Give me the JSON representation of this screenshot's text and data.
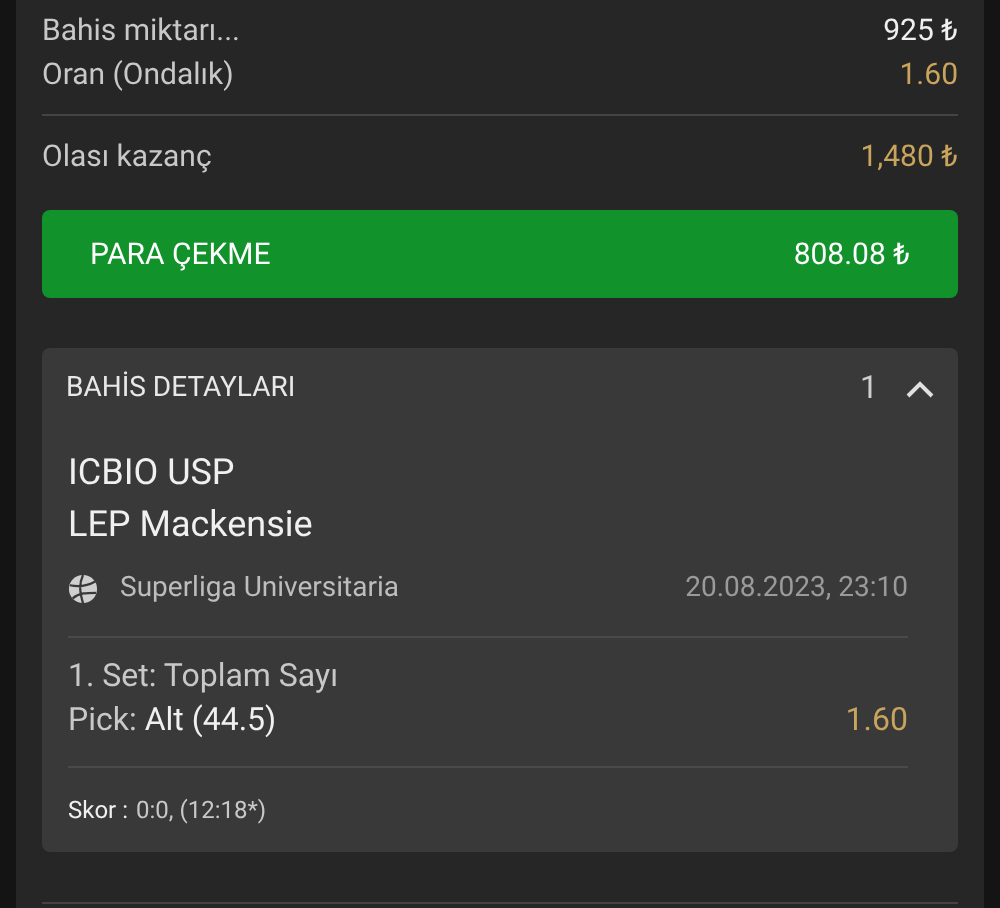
{
  "summary": [
    {
      "label": "Bahis miktarı...",
      "value": "925 ₺",
      "kind": "plain"
    },
    {
      "label": "Oran (Ondalık)",
      "value": "1.60",
      "kind": "odds"
    }
  ],
  "potential": {
    "label": "Olası kazanç",
    "value": "1,480 ₺"
  },
  "cashout": {
    "label": "PARA ÇEKME",
    "amount": "808.08 ₺"
  },
  "details": {
    "title": "BAHİS DETAYLARI",
    "count": "1",
    "expanded": true,
    "teams": [
      "ICBIO USP",
      "LEP Mackensie"
    ],
    "league": "Superliga Universitaria",
    "date": "20.08.2023, 23:10",
    "market": "1. Set: Toplam Sayı",
    "pick_label": "Pick:",
    "pick_value": "Alt (44.5)",
    "odds": "1.60",
    "score_label": "Skor :",
    "score_value": "0:0, (12:18*)"
  }
}
